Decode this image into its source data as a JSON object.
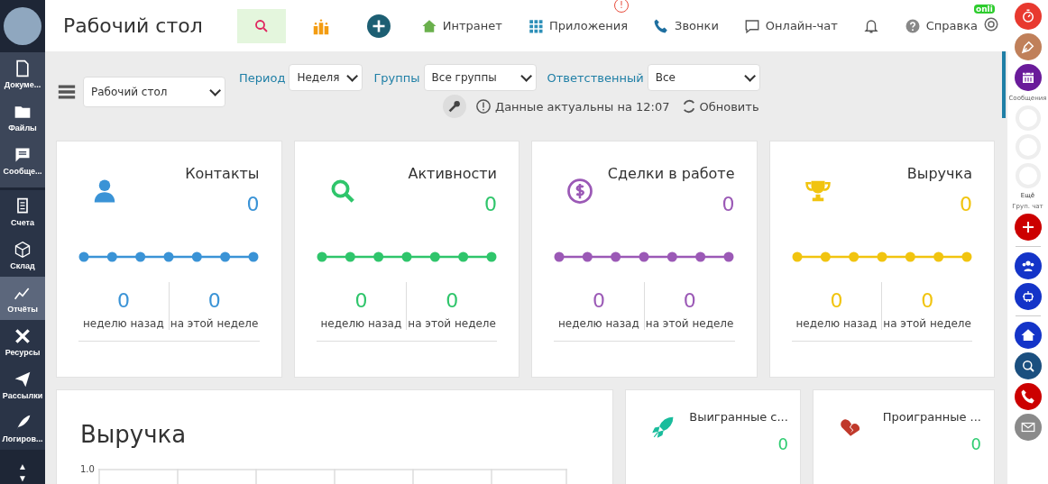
{
  "sidebar": {
    "pinned": [
      {
        "label": "Докуме..."
      },
      {
        "label": "Файлы"
      },
      {
        "label": "Сообще..."
      }
    ],
    "items": [
      {
        "label": "Счета",
        "selected": false
      },
      {
        "label": "Склад",
        "selected": false
      },
      {
        "label": "Отчёты",
        "selected": true
      },
      {
        "label": "Ресурсы",
        "selected": false
      },
      {
        "label": "Рассылки",
        "selected": false
      },
      {
        "label": "Логиров...",
        "selected": false
      }
    ],
    "scroll": [
      "▲",
      "▼"
    ]
  },
  "topbar": {
    "title": "Рабочий стол",
    "nav": [
      {
        "label": "Интранет"
      },
      {
        "label": "Приложения",
        "badge": "!"
      },
      {
        "label": "Звонки"
      },
      {
        "label": "Онлайн-чат"
      }
    ],
    "help": "Справка",
    "online_badge": "onli"
  },
  "filters": {
    "dashboard": "Рабочий стол",
    "period_label": "Период",
    "period": "Неделя",
    "groups_label": "Группы",
    "groups": "Все группы",
    "owner_label": "Ответственный",
    "owner": "Все",
    "status": "Данные актуальны на 12:07",
    "refresh": "Обновить"
  },
  "stats": [
    {
      "title": "Контакты",
      "value": "0",
      "color": "#3a93d6",
      "prev": "0",
      "prev_label": "неделю назад",
      "curr": "0",
      "curr_label": "на этой неделе"
    },
    {
      "title": "Активности",
      "value": "0",
      "color": "#2fc56b",
      "prev": "0",
      "prev_label": "неделю назад",
      "curr": "0",
      "curr_label": "на этой неделе"
    },
    {
      "title": "Сделки в работе",
      "value": "0",
      "color": "#9b59b6",
      "prev": "0",
      "prev_label": "неделю назад",
      "curr": "0",
      "curr_label": "на этой неделе"
    },
    {
      "title": "Выручка",
      "value": "0",
      "color": "#f1c40f",
      "prev": "0",
      "prev_label": "неделю назад",
      "curr": "0",
      "curr_label": "на этой неделе"
    }
  ],
  "revenue": {
    "title": "Выручка",
    "ytick": "1.0"
  },
  "deals": [
    {
      "title": "Выигранные с...",
      "value": "0"
    },
    {
      "title": "Проигранные ...",
      "value": "0"
    }
  ],
  "rail": {
    "messages_label": "Сообщения",
    "more_label": "Ещё",
    "group_chat_label": "Груп. чат"
  }
}
